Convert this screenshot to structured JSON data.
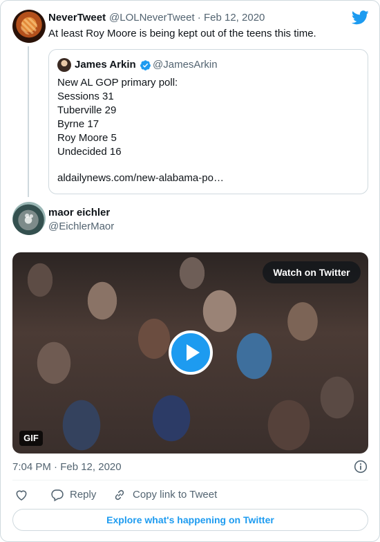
{
  "tweet": {
    "author_name": "NeverTweet",
    "author_handle": "@LOLNeverTweet",
    "date": "Feb 12, 2020",
    "separator": "·",
    "text": "At least Roy Moore is being kept out of the teens this time."
  },
  "quoted": {
    "author_name": "James Arkin",
    "author_handle": "@JamesArkin",
    "lines": [
      "New AL GOP primary poll:",
      "Sessions 31",
      "Tuberville 29",
      "Byrne 17",
      "Roy Moore 5",
      "Undecided 16"
    ],
    "link": "aldailynews.com/new-alabama-po…"
  },
  "reply": {
    "author_name": "maor eichler",
    "author_handle": "@EichlerMaor"
  },
  "media": {
    "watch_label": "Watch on Twitter",
    "badge": "GIF"
  },
  "footer": {
    "timestamp": "7:04 PM · Feb 12, 2020",
    "reply_label": "Reply",
    "copy_label": "Copy link to Tweet",
    "explore_label": "Explore what's happening on Twitter"
  },
  "icons": {
    "twitter": "twitter-bird-icon",
    "verified": "verified-badge-icon",
    "play": "play-icon",
    "info": "info-icon",
    "like": "heart-icon",
    "reply": "reply-bubble-icon",
    "copy": "link-icon"
  },
  "colors": {
    "brand": "#1d9bf0",
    "text": "#0f1419",
    "secondary": "#536471",
    "border": "#cfd9de"
  }
}
